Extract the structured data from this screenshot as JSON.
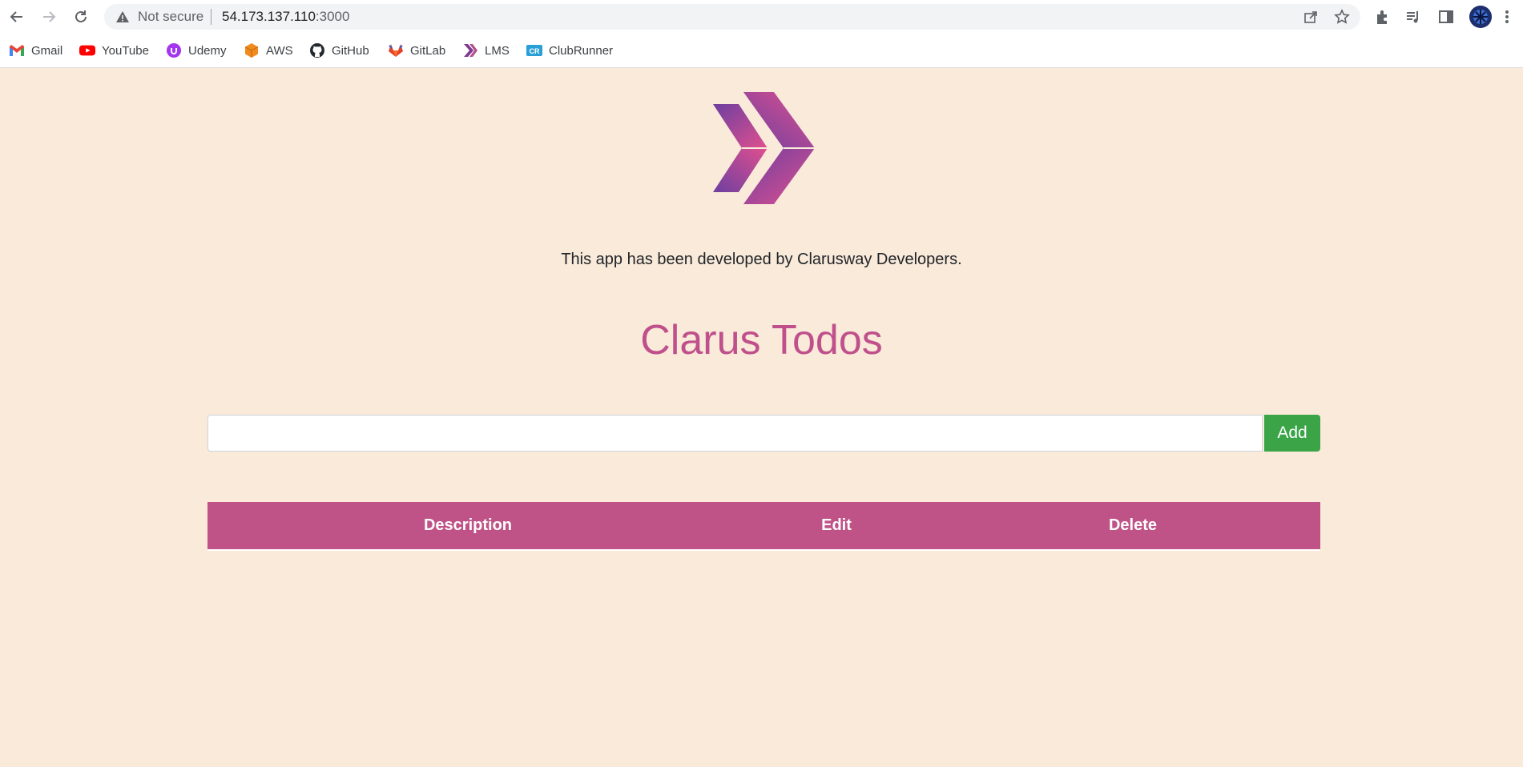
{
  "browser": {
    "security_label": "Not secure",
    "url_host": "54.173.137.110",
    "url_port": ":3000",
    "icons": [
      "back-arrow-icon",
      "forward-arrow-icon",
      "reload-icon",
      "warning-icon",
      "share-icon",
      "star-icon",
      "extensions-icon",
      "media-icon",
      "side-panel-icon",
      "profile-avatar",
      "menu-dots-icon"
    ]
  },
  "bookmarks": [
    {
      "label": "Gmail",
      "icon": "gmail-icon"
    },
    {
      "label": "YouTube",
      "icon": "youtube-icon"
    },
    {
      "label": "Udemy",
      "icon": "udemy-icon"
    },
    {
      "label": "AWS",
      "icon": "aws-icon"
    },
    {
      "label": "GitHub",
      "icon": "github-icon"
    },
    {
      "label": "GitLab",
      "icon": "gitlab-icon"
    },
    {
      "label": "LMS",
      "icon": "lms-icon"
    },
    {
      "label": "ClubRunner",
      "icon": "clubrunner-icon"
    }
  ],
  "app": {
    "credit": "This app has been developed by Clarusway Developers.",
    "title": "Clarus Todos",
    "input_value": "",
    "add_label": "Add",
    "columns": [
      "Description",
      "Edit",
      "Delete"
    ],
    "colors": {
      "background": "#f9eada",
      "accent": "#c0508b",
      "add_button": "#3aa447"
    }
  }
}
